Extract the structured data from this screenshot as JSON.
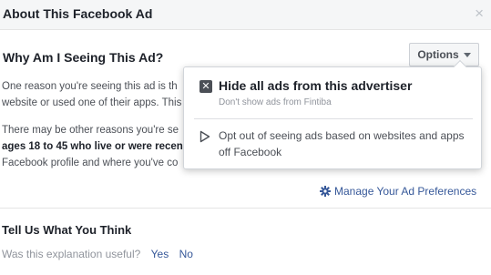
{
  "dialog": {
    "title": "About This Facebook Ad",
    "close_symbol": "×"
  },
  "why": {
    "heading": "Why Am I Seeing This Ad?",
    "options_label": "Options",
    "para1_line1": "One reason you're seeing this ad is th",
    "para1_line2": "website or used one of their apps. This",
    "para2_line1": "There may be other reasons you're se",
    "para2_line2_bold": "ages 18 to 45 who live or were recen",
    "para2_line3": "Facebook profile and where you've co"
  },
  "manage": {
    "label": "Manage Your Ad Preferences"
  },
  "feedback": {
    "heading": "Tell Us What You Think",
    "question": "Was this explanation useful?",
    "yes": "Yes",
    "no": "No"
  },
  "menu": {
    "item1_title": "Hide all ads from this advertiser",
    "item1_subtitle": "Don't show ads from Fintiba",
    "item1_icon_symbol": "✕",
    "item2_label": "Opt out of seeing ads based on websites and apps off Facebook"
  },
  "colors": {
    "link": "#365899",
    "text": "#1d2129",
    "muted": "#90949c"
  }
}
